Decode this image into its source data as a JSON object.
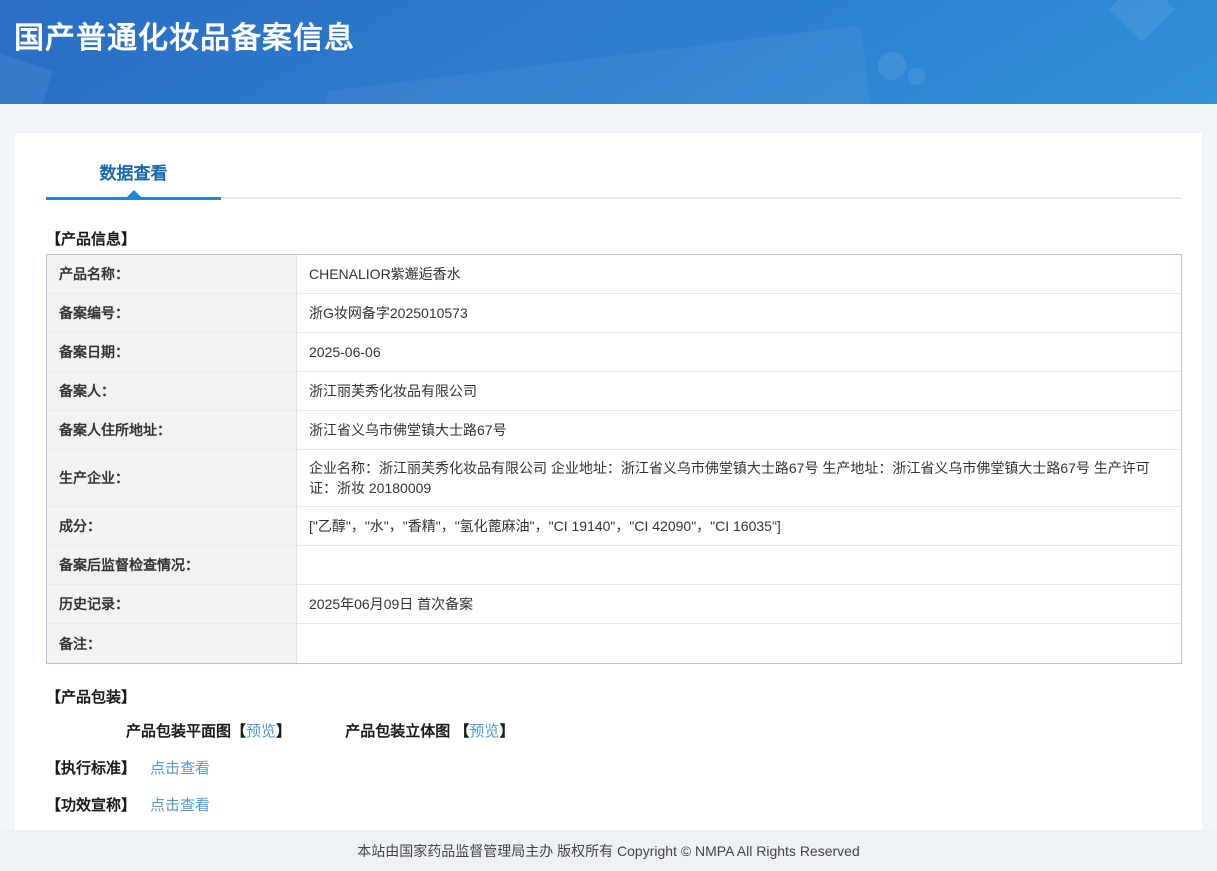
{
  "header": {
    "title": "国产普通化妆品备案信息"
  },
  "tabs": {
    "data_view": "数据查看"
  },
  "product_info": {
    "section_title": "【产品信息】",
    "rows": [
      {
        "label": "产品名称：",
        "value": "CHENALIOR紫邂逅香水"
      },
      {
        "label": "备案编号：",
        "value": "浙G妆网备字2025010573"
      },
      {
        "label": "备案日期：",
        "value": "2025-06-06"
      },
      {
        "label": "备案人：",
        "value": "浙江丽芙秀化妆品有限公司"
      },
      {
        "label": "备案人住所地址：",
        "value": "浙江省义乌市佛堂镇大士路67号"
      },
      {
        "label": "生产企业：",
        "value": "企业名称：浙江丽芙秀化妆品有限公司 企业地址：浙江省义乌市佛堂镇大士路67号 生产地址：浙江省义乌市佛堂镇大士路67号 生产许可证：浙妆 20180009"
      },
      {
        "label": "成分：",
        "value": "[\"乙醇\"，\"水\"，\"香精\"，\"氢化蓖麻油\"，\"CI 19140\"，\"CI 42090\"，\"CI 16035\"]"
      },
      {
        "label": "备案后监督检查情况：",
        "value": ""
      },
      {
        "label": "历史记录：",
        "value": "2025年06月09日 首次备案"
      },
      {
        "label": "备注：",
        "value": ""
      }
    ]
  },
  "packaging": {
    "section_title": "【产品包装】",
    "items": [
      {
        "label": "产品包装平面图",
        "bracket_open": "【",
        "link": "预览",
        "bracket_close": "】"
      },
      {
        "label": "产品包装立体图 ",
        "bracket_open": "【",
        "link": "预览",
        "bracket_close": "】"
      }
    ]
  },
  "standard": {
    "section_title": "【执行标准】",
    "link": "点击查看"
  },
  "efficacy": {
    "section_title": "【功效宣称】",
    "link": "点击查看"
  },
  "footer": {
    "text": "本站由国家药品监督管理局主办 版权所有 Copyright © NMPA All Rights Reserved"
  },
  "colors": {
    "header_gradient_start": "#2a6ec4",
    "header_gradient_end": "#3191da",
    "tab_text": "#1568b4",
    "tab_underline": "#1e86d6",
    "link": "#4e9ad6",
    "table_border": "#abc6e6",
    "label_cell_bg": "#f2f2f2",
    "footer_bg": "#eef1f5"
  }
}
